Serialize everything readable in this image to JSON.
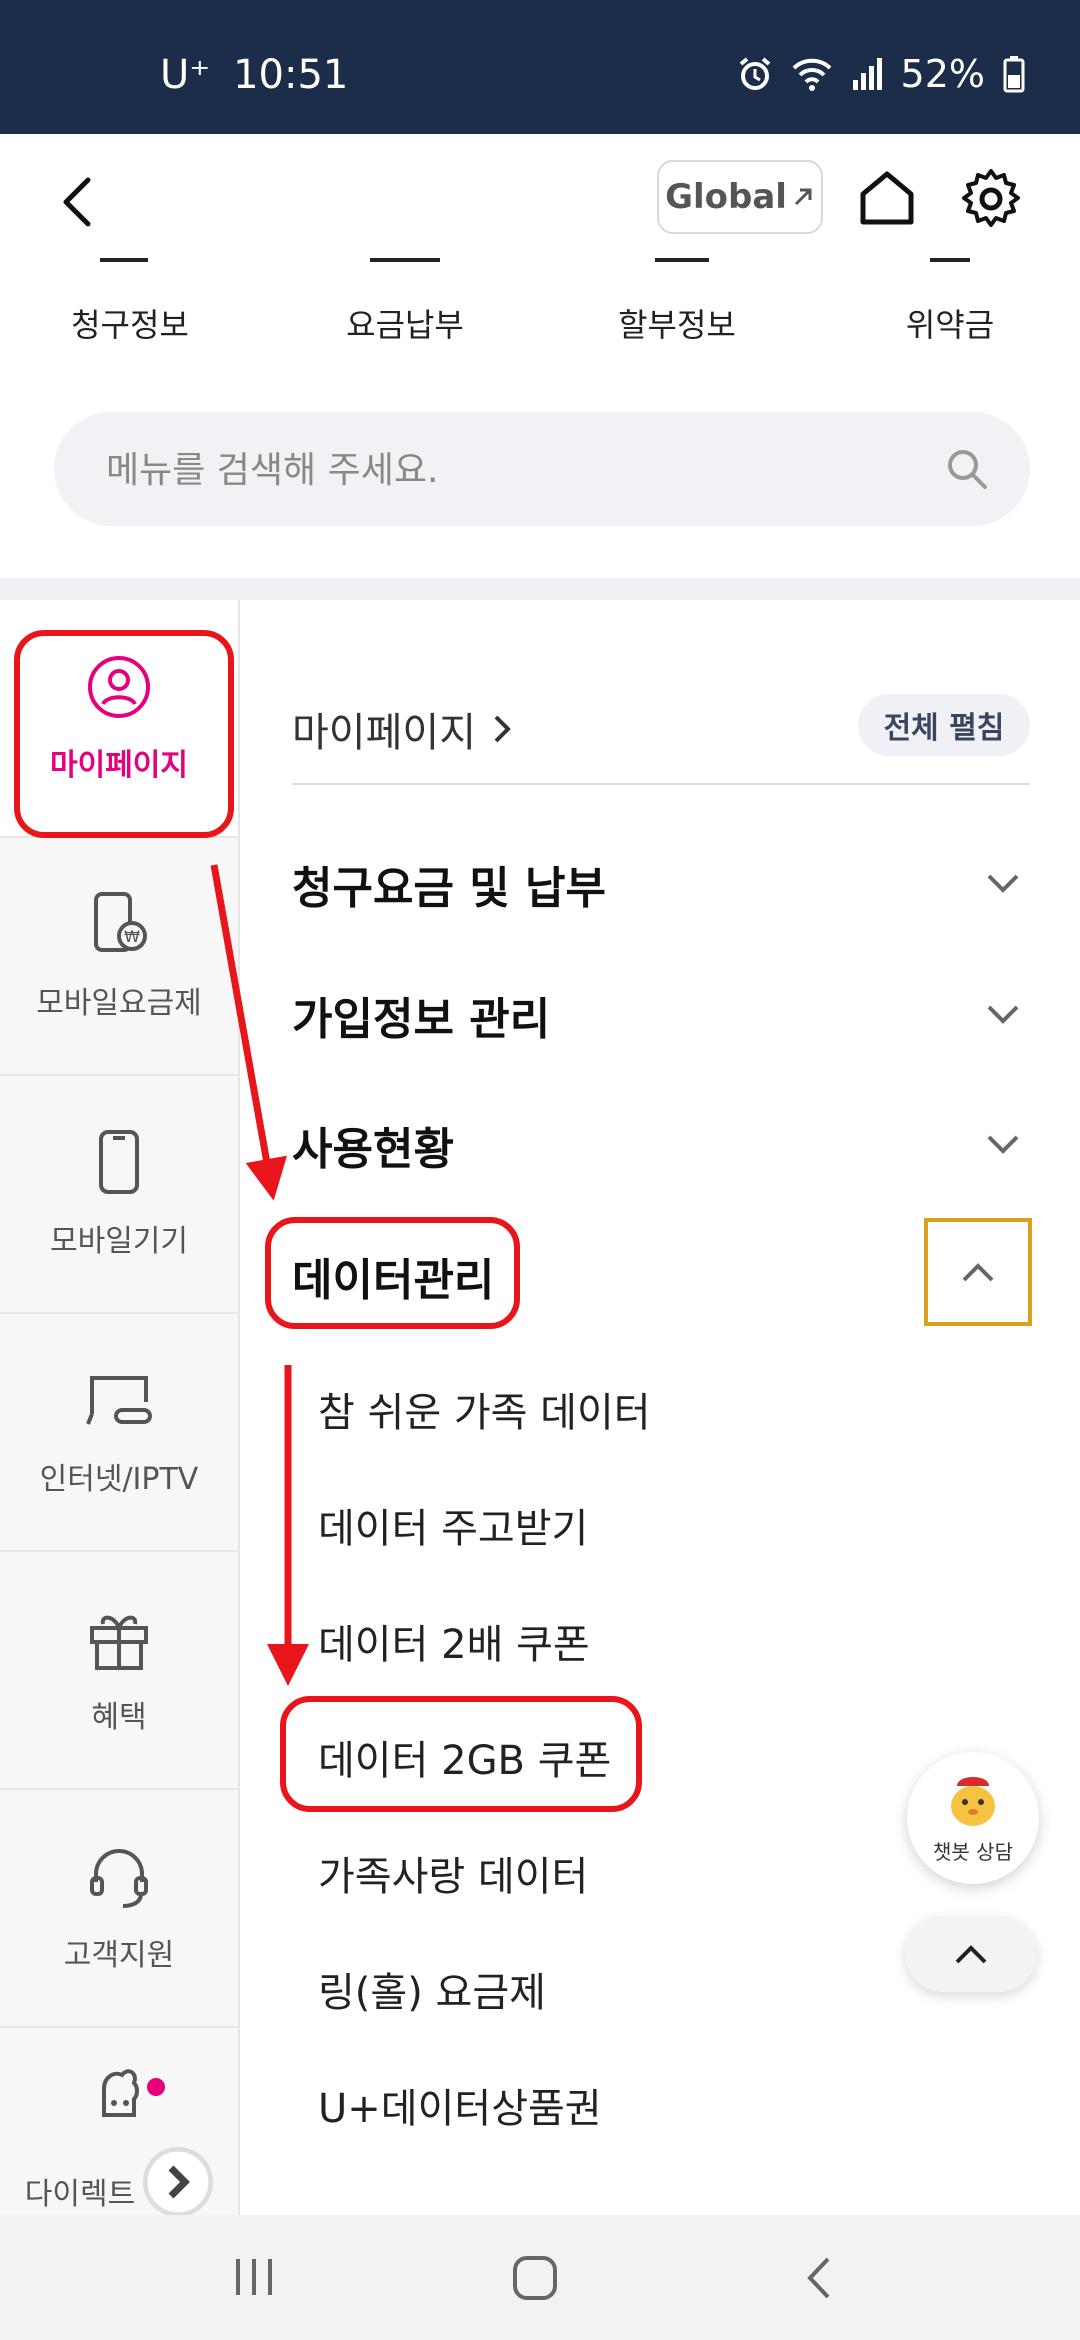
{
  "status_bar": {
    "carrier": "U⁺",
    "time": "10:51",
    "battery": "52%",
    "icons": [
      "alarm-icon",
      "wifi-icon",
      "signal-icon",
      "battery-icon"
    ]
  },
  "header": {
    "global_label": "Global",
    "icons": [
      "back-arrow-icon",
      "external-link-icon",
      "home-icon",
      "gear-icon"
    ]
  },
  "quick_menu": [
    "청구정보",
    "요금납부",
    "할부정보",
    "위약금"
  ],
  "search": {
    "placeholder": "메뉴를 검색해 주세요."
  },
  "sidebar": {
    "items": [
      {
        "label": "마이페이지",
        "icon": "user-circle-icon"
      },
      {
        "label": "모바일요금제",
        "icon": "phone-won-icon"
      },
      {
        "label": "모바일기기",
        "icon": "phone-icon"
      },
      {
        "label": "인터넷/IPTV",
        "icon": "tv-icon"
      },
      {
        "label": "혜택",
        "icon": "gift-icon"
      },
      {
        "label": "고객지원",
        "icon": "headset-icon"
      },
      {
        "label": "다이렉트",
        "icon": "mascot-icon"
      }
    ]
  },
  "content": {
    "breadcrumb": "마이페이지",
    "expand_all": "전체 펼침",
    "categories": [
      "청구요금 및 납부",
      "가입정보 관리",
      "사용현황",
      "데이터관리"
    ],
    "sub_items": [
      "참 쉬운 가족 데이터",
      "데이터 주고받기",
      "데이터 2배 쿠폰",
      "데이터 2GB 쿠폰",
      "가족사랑 데이터",
      "링(홀) 요금제",
      "U+데이터상품권"
    ]
  },
  "floating": {
    "chatbot_label": "챗봇 상담"
  },
  "colors": {
    "status_bar": "#1c2d4a",
    "accent": "#e5007e",
    "highlight": "#e8161b",
    "focus": "#d9a21b"
  }
}
